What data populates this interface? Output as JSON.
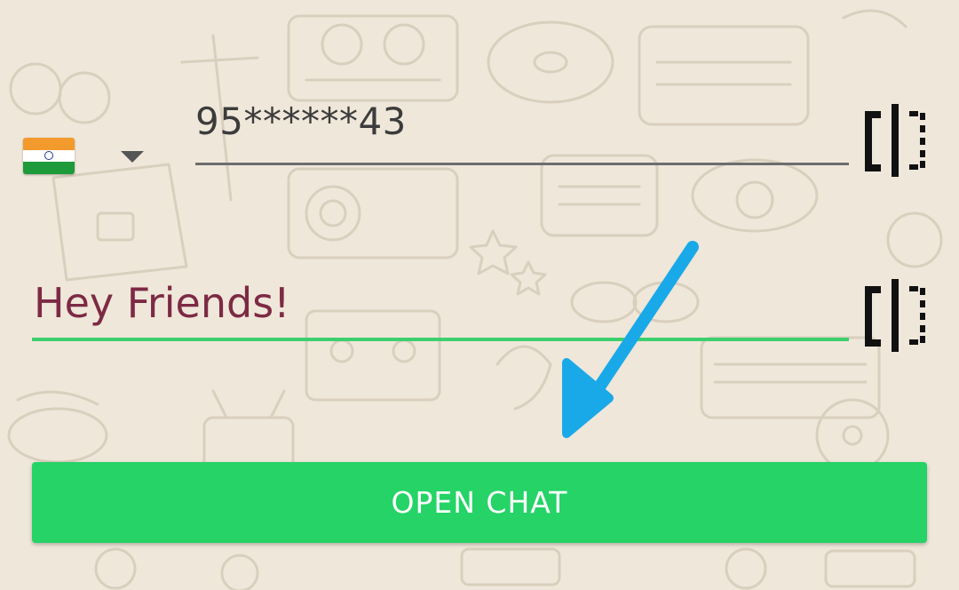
{
  "country": {
    "flag_icon": "india-flag-icon",
    "dropdown_icon": "caret-down-icon"
  },
  "phone": {
    "value": "95******43"
  },
  "message": {
    "value": "Hey Friends!"
  },
  "paste_icon": "paste-icon",
  "open_chat": {
    "label": "OPEN CHAT"
  },
  "colors": {
    "background": "#efe7da",
    "button": "#25d366",
    "message_text": "#7d2a44",
    "active_underline": "#3ccf6e",
    "arrow": "#1aa9e8"
  },
  "annotation": {
    "icon": "arrow-icon"
  }
}
